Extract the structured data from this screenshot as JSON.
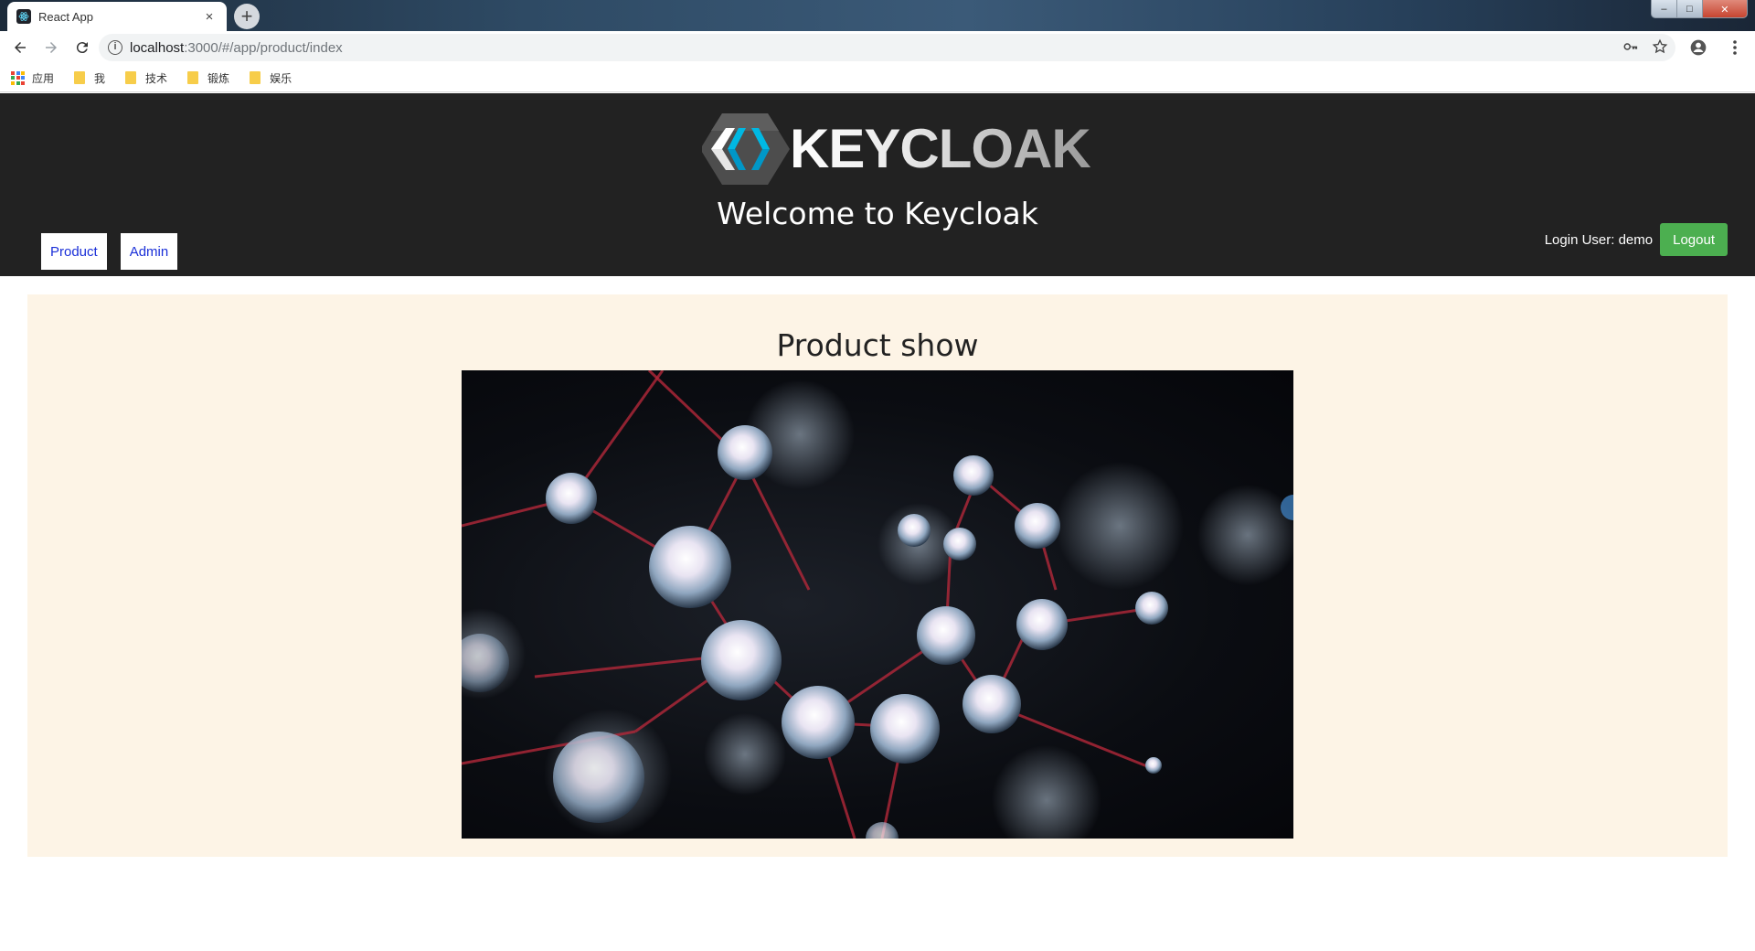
{
  "browser": {
    "tab_title": "React App",
    "tab_close": "×",
    "new_tab": "+",
    "url_host": "localhost",
    "url_path": ":3000/#/app/product/index",
    "window_controls": {
      "minimize": "–",
      "maximize": "□",
      "close": "✕"
    }
  },
  "bookmarks": {
    "apps_label": "应用",
    "items": [
      {
        "label": "我"
      },
      {
        "label": "技术"
      },
      {
        "label": "锻炼"
      },
      {
        "label": "娱乐"
      }
    ]
  },
  "header": {
    "logo_text": "KEYCLOAK",
    "welcome": "Welcome to Keycloak",
    "nav": [
      {
        "label": "Product"
      },
      {
        "label": "Admin"
      }
    ],
    "login_user": "Login User: demo",
    "logout_label": "Logout",
    "logout_color": "#4caf50",
    "background_color": "#222222",
    "link_color": "#1a2fd8"
  },
  "content": {
    "title": "Product show",
    "background_color": "#fdf4e6",
    "image": "molecular-network-image"
  }
}
